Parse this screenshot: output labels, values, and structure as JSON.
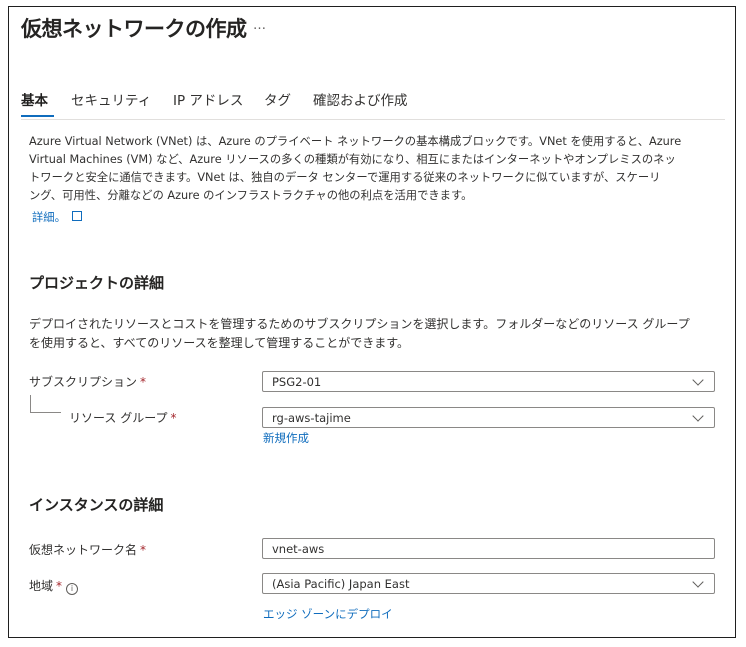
{
  "page": {
    "title": "仮想ネットワークの作成",
    "more_label": "…"
  },
  "tabs": [
    {
      "label": "基本",
      "active": true
    },
    {
      "label": "セキュリティ",
      "active": false
    },
    {
      "label": "IP アドレス",
      "active": false
    },
    {
      "label": "タグ",
      "active": false
    },
    {
      "label": "確認および作成",
      "active": false
    }
  ],
  "intro": {
    "text": "Azure Virtual Network (VNet) は、Azure のプライベート ネットワークの基本構成ブロックです。VNet を使用すると、Azure\nVirtual Machines (VM) など、Azure リソースの多くの種類が有効になり、相互にまたはインターネットやオンプレミスのネッ\nトワークと安全に通信できます。VNet は、独自のデータ センターで運用する従来のネットワークに似ていますが、スケーリ\nング、可用性、分離などの Azure のインフラストラクチャの他の利点を活用できます。",
    "learn_more": "詳細。"
  },
  "project": {
    "title": "プロジェクトの詳細",
    "description": "デプロイされたリソースとコストを管理するためのサブスクリプションを選択します。フォルダーなどのリソース グループ\nを使用すると、すべてのリソースを整理して管理することができます。",
    "subscription_label": "サブスクリプション",
    "subscription_value": "PSG2-01",
    "rg_label": "リソース グループ",
    "rg_value": "rg-aws-tajime",
    "rg_create_new": "新規作成"
  },
  "instance": {
    "title": "インスタンスの詳細",
    "name_label": "仮想ネットワーク名",
    "name_value": "vnet-aws",
    "region_label": "地域",
    "region_value": "(Asia Pacific) Japan East",
    "edge_zone_link": "エッジ ゾーンにデプロイ"
  },
  "required_marker": "*",
  "info_glyph": "i",
  "colors": {
    "accent": "#0f6cbd",
    "required": "#a4262c",
    "border": "#8a8886"
  }
}
